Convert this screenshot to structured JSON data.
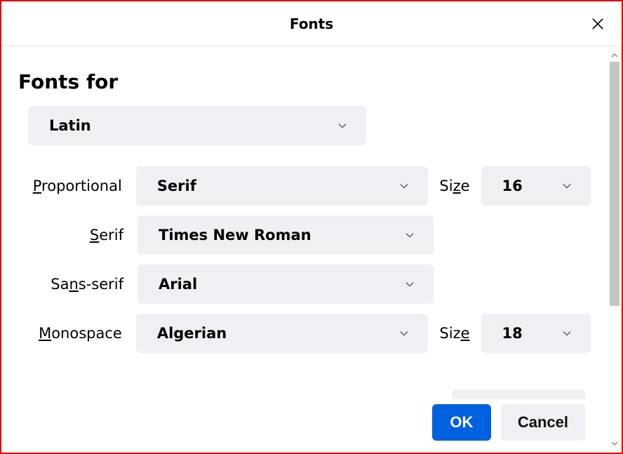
{
  "titlebar": {
    "title": "Fonts"
  },
  "header": {
    "label": "Fonts for"
  },
  "language": {
    "selected": "Latin"
  },
  "rows": {
    "proportional": {
      "label_pre": "",
      "label_ul": "P",
      "label_post": "roportional",
      "font": "Serif",
      "size_label_pre": "Si",
      "size_label_ul": "z",
      "size_label_post": "e",
      "size": "16"
    },
    "serif": {
      "label_pre": "",
      "label_ul": "S",
      "label_post": "erif",
      "font": "Times New Roman"
    },
    "sans": {
      "label_pre": "Sa",
      "label_ul": "n",
      "label_post": "s-serif",
      "font": "Arial"
    },
    "mono": {
      "label_pre": "",
      "label_ul": "M",
      "label_post": "onospace",
      "font": "Algerian",
      "size_label_pre": "Siz",
      "size_label_ul": "e",
      "size_label_post": "",
      "size": "18"
    }
  },
  "footer": {
    "ok": "OK",
    "cancel": "Cancel"
  }
}
